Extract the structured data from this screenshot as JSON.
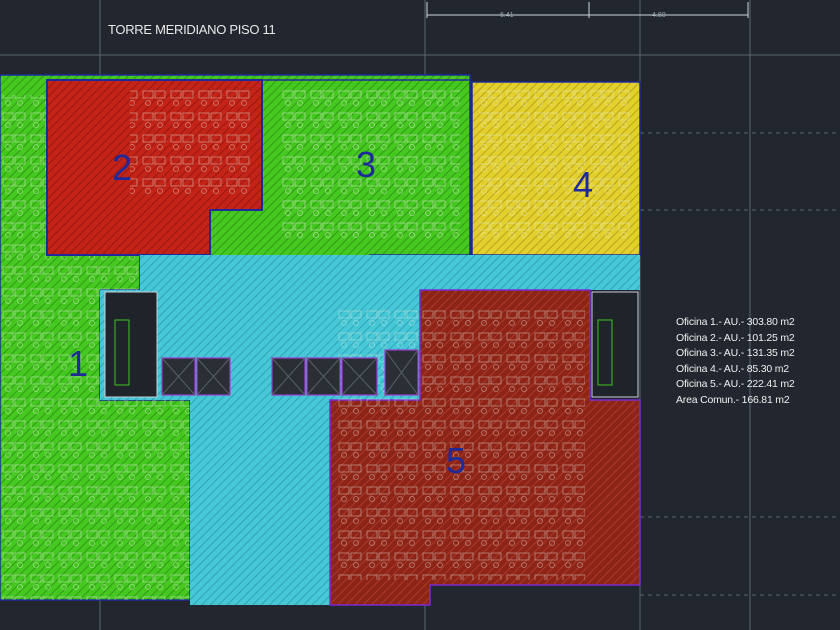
{
  "title": "TORRE MERIDIANO PISO 11",
  "dimensions": [
    "6.41",
    "4.80"
  ],
  "offices": [
    {
      "number": "1",
      "color": "#3ec41e"
    },
    {
      "number": "2",
      "color": "#c8221a"
    },
    {
      "number": "3",
      "color": "#3ec41e"
    },
    {
      "number": "4",
      "color": "#e6d22a"
    },
    {
      "number": "5",
      "color": "#8e2418"
    }
  ],
  "common_area_color": "#3fc6d6",
  "area_list": [
    "Oficina 1.- AU.- 303.80 m2",
    "Oficina 2.- AU.- 101.25 m2",
    "Oficina 3.- AU.- 131.35 m2",
    "Oficina 4.- AU.- 85.30 m2",
    "Oficina 5.- AU.- 222.41 m2",
    "Area Comun.- 166.81 m2"
  ]
}
